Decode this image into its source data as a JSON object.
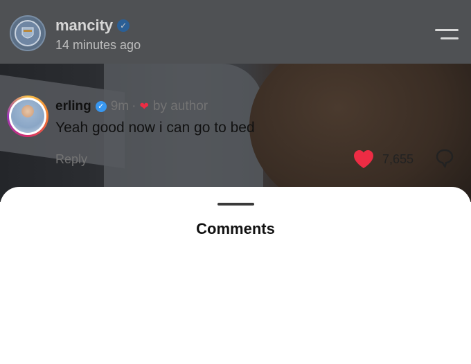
{
  "post": {
    "username": "mancity",
    "time": "14 minutes ago",
    "avatar_icon": "club-crest-icon",
    "menu_icon": "hamburger-menu-icon"
  },
  "sheet": {
    "title": "Comments"
  },
  "comment": {
    "username": "erling",
    "time": "9m",
    "separator": "·",
    "liked_by_author": "by author",
    "text": "Yeah good now i can go to bed",
    "reply_label": "Reply",
    "like_count": "7,655",
    "like_color": "#ed2c44",
    "verified_color": "#3897f0"
  }
}
